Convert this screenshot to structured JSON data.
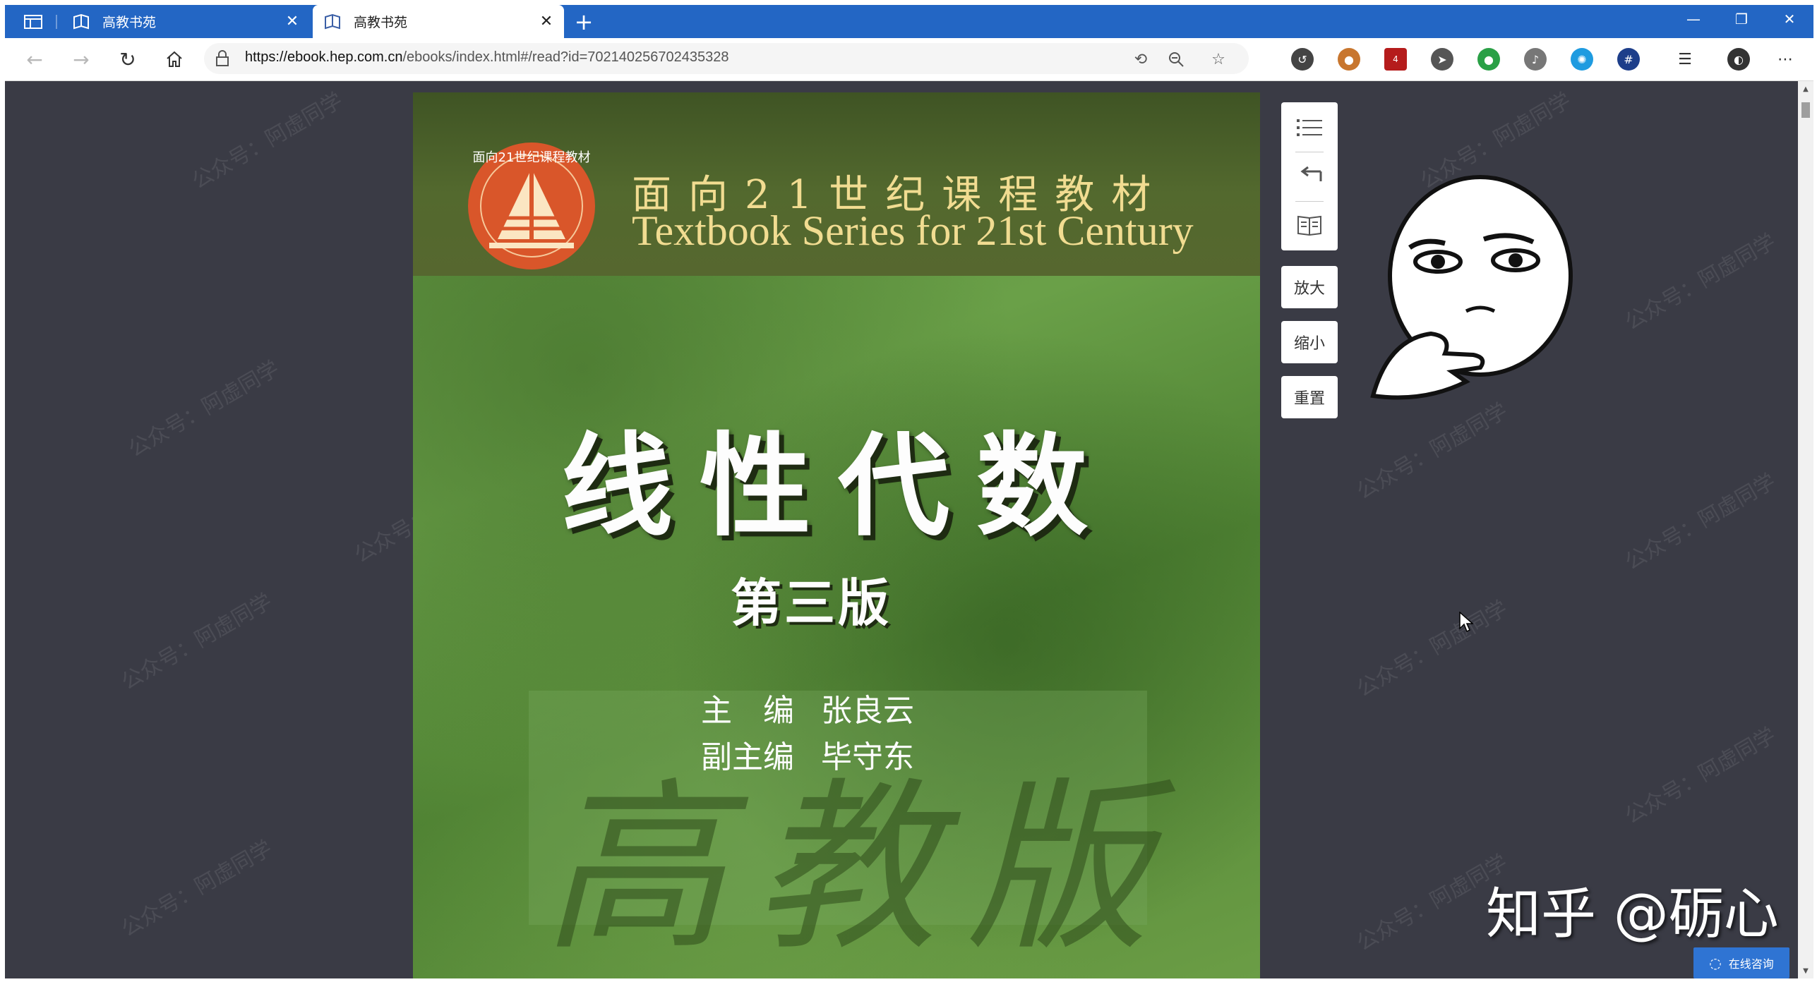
{
  "browser": {
    "tabs": [
      {
        "title": "高教书苑",
        "active": false
      },
      {
        "title": "高教书苑",
        "active": true
      }
    ],
    "new_tab_label": "+",
    "window_controls": {
      "minimize": "—",
      "restore": "❐",
      "close": "✕"
    },
    "url_host": "https://ebook.hep.com.cn",
    "url_path": "/ebooks/index.html#/read?id=702140256702435328",
    "extension_badge": "4"
  },
  "book": {
    "series_cn": "面向21世纪课程教材",
    "series_en": "Textbook Series for 21st Century",
    "title": "线性代数",
    "edition": "第三版",
    "editor_role": "主　编",
    "editor_name": "张良云",
    "deputy_role": "副主编",
    "deputy_name": "毕守东",
    "logo_text": "面向21世纪课程教材",
    "background_calligraphy": "高教版"
  },
  "reader_controls": {
    "zoom_in": "放大",
    "zoom_out": "缩小",
    "reset": "重置",
    "icons": [
      "list-icon",
      "back-arrow-icon",
      "open-book-icon"
    ]
  },
  "overlay": {
    "watermark": "公众号：阿虚同学",
    "signature": "知乎 @砺心",
    "consult": "在线咨询"
  },
  "colors": {
    "tabbar": "#2366c4",
    "content_bg": "#3a3b45",
    "cover_green": "#6aa048",
    "series_gold": "#f1dc91"
  }
}
